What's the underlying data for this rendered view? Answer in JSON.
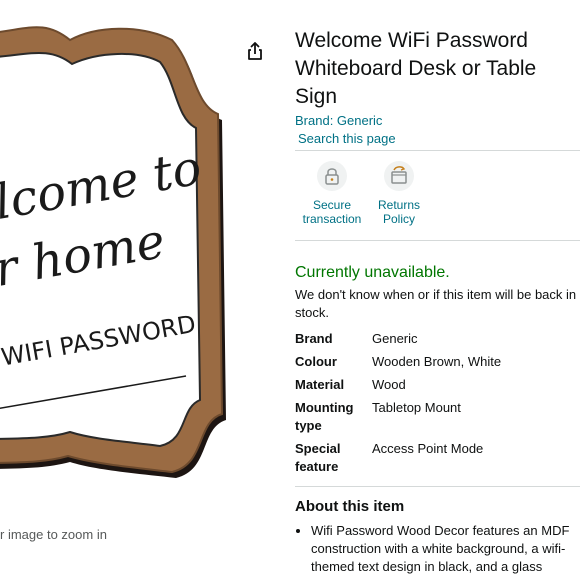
{
  "gallery": {
    "sign_script_line1": "lcome to",
    "sign_script_line2": "r home",
    "sign_wifi_text": "WIFI PASSWORD",
    "zoom_hint": "r image to zoom in"
  },
  "product": {
    "title": "Welcome WiFi Password Whiteboard Desk or Table Sign",
    "brand_link": "Brand: Generic",
    "search_link": "Search this page"
  },
  "features": [
    {
      "label": "Secure transaction",
      "icon": "padlock-icon"
    },
    {
      "label": "Returns Policy",
      "icon": "returns-box-icon"
    }
  ],
  "availability": {
    "status": "Currently unavailable.",
    "note": "We don't know when or if this item will be back in stock."
  },
  "specs": [
    {
      "label": "Brand",
      "value": "Generic"
    },
    {
      "label": "Colour",
      "value": "Wooden Brown, White"
    },
    {
      "label": "Material",
      "value": "Wood"
    },
    {
      "label": "Mounting type",
      "value": "Tabletop Mount"
    },
    {
      "label": "Special feature",
      "value": "Access Point Mode"
    }
  ],
  "about": {
    "title": "About this item",
    "bullets": [
      "Wifi Password Wood Decor features an MDF construction with a white background, a wifi-themed text design in black, and a glass"
    ]
  },
  "colors": {
    "link": "#007185",
    "available_green": "#007600",
    "wood": "#9a6b43",
    "text": "#0f1111"
  }
}
